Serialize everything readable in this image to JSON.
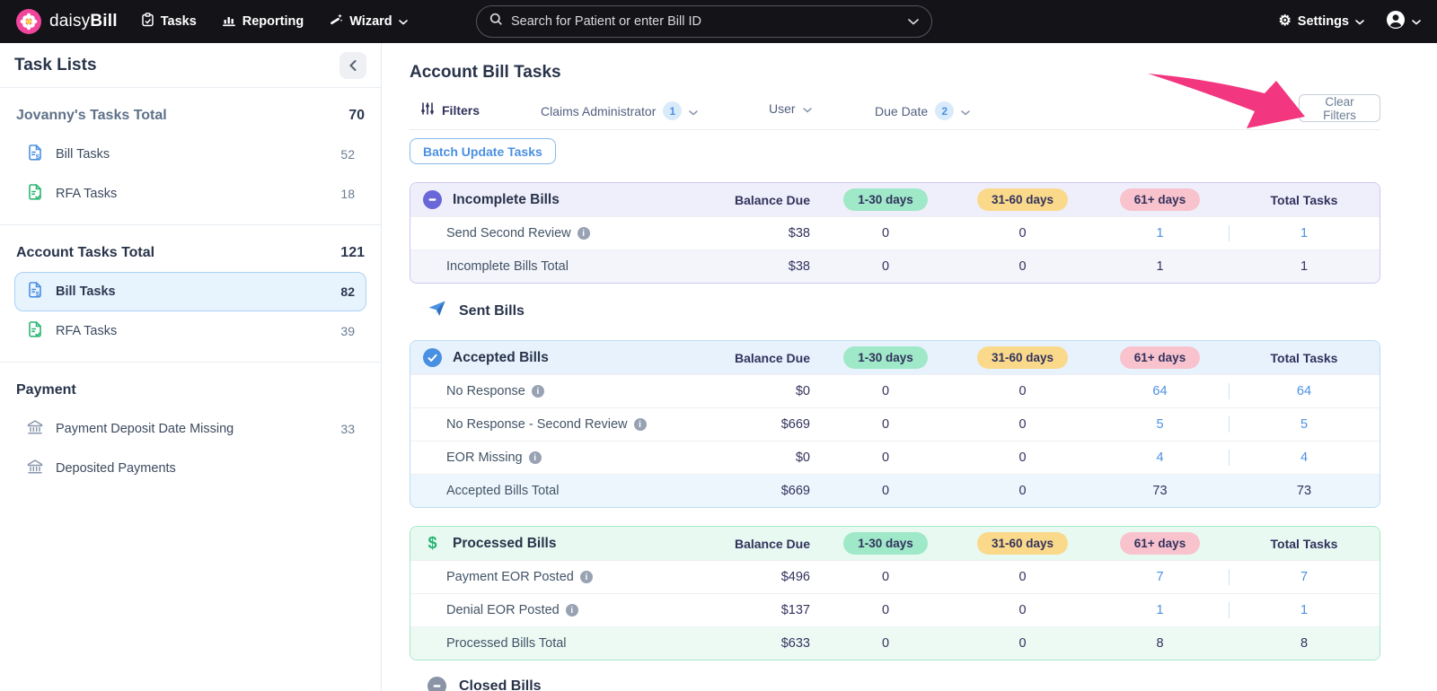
{
  "nav": {
    "brand_daisy": "daisy",
    "brand_bill": "Bill",
    "tasks": "Tasks",
    "reporting": "Reporting",
    "wizard": "Wizard",
    "search_placeholder": "Search for Patient or enter Bill ID",
    "settings": "Settings"
  },
  "sidebar": {
    "title": "Task Lists",
    "my_section": {
      "header": "Jovanny's Tasks Total",
      "count": "70",
      "bill": {
        "label": "Bill Tasks",
        "count": "52"
      },
      "rfa": {
        "label": "RFA Tasks",
        "count": "18"
      }
    },
    "account_section": {
      "header": "Account Tasks Total",
      "count": "121",
      "bill": {
        "label": "Bill Tasks",
        "count": "82"
      },
      "rfa": {
        "label": "RFA Tasks",
        "count": "39"
      }
    },
    "payment_section": {
      "header": "Payment",
      "deposit_missing": {
        "label": "Payment Deposit Date Missing",
        "count": "33"
      },
      "deposited": {
        "label": "Deposited Payments"
      }
    }
  },
  "main": {
    "title": "Account Bill Tasks",
    "filters": {
      "label": "Filters",
      "claims_admin": {
        "label": "Claims Administrator",
        "badge": "1"
      },
      "user": {
        "label": "User"
      },
      "due_date": {
        "label": "Due Date",
        "badge": "2"
      },
      "clear": "Clear Filters"
    },
    "batch_button": "Batch Update Tasks",
    "columns": {
      "balance": "Balance Due",
      "d1": "1-30 days",
      "d2": "31-60 days",
      "d3": "61+ days",
      "total": "Total Tasks"
    },
    "sent_header": "Sent Bills",
    "closed_header": "Closed Bills",
    "cards": [
      {
        "title": "Incomplete Bills",
        "rows": [
          {
            "name": "Send Second Review",
            "balance": "$38",
            "d1": "0",
            "d2": "0",
            "d3": "1",
            "total": "1"
          }
        ],
        "total_row": {
          "name": "Incomplete Bills Total",
          "balance": "$38",
          "d1": "0",
          "d2": "0",
          "d3": "1",
          "total": "1"
        }
      },
      {
        "title": "Accepted Bills",
        "rows": [
          {
            "name": "No Response",
            "balance": "$0",
            "d1": "0",
            "d2": "0",
            "d3": "64",
            "total": "64"
          },
          {
            "name": "No Response - Second Review",
            "balance": "$669",
            "d1": "0",
            "d2": "0",
            "d3": "5",
            "total": "5"
          },
          {
            "name": "EOR Missing",
            "balance": "$0",
            "d1": "0",
            "d2": "0",
            "d3": "4",
            "total": "4"
          }
        ],
        "total_row": {
          "name": "Accepted Bills Total",
          "balance": "$669",
          "d1": "0",
          "d2": "0",
          "d3": "73",
          "total": "73"
        }
      },
      {
        "title": "Processed Bills",
        "rows": [
          {
            "name": "Payment EOR Posted",
            "balance": "$496",
            "d1": "0",
            "d2": "0",
            "d3": "7",
            "total": "7"
          },
          {
            "name": "Denial EOR Posted",
            "balance": "$137",
            "d1": "0",
            "d2": "0",
            "d3": "1",
            "total": "1"
          }
        ],
        "total_row": {
          "name": "Processed Bills Total",
          "balance": "$633",
          "d1": "0",
          "d2": "0",
          "d3": "8",
          "total": "8"
        }
      }
    ]
  },
  "colors": {
    "accent_blue": "#4a90e2",
    "brand_pink": "#f2459c",
    "incomplete_purple": "#6a67d8",
    "processed_green": "#27b473",
    "pill_green": "#9fe8c8",
    "pill_yellow": "#fad98a",
    "pill_pink": "#f9c3cd",
    "annotation_arrow_pink": "#f2367f",
    "topbar_black": "#131318"
  }
}
